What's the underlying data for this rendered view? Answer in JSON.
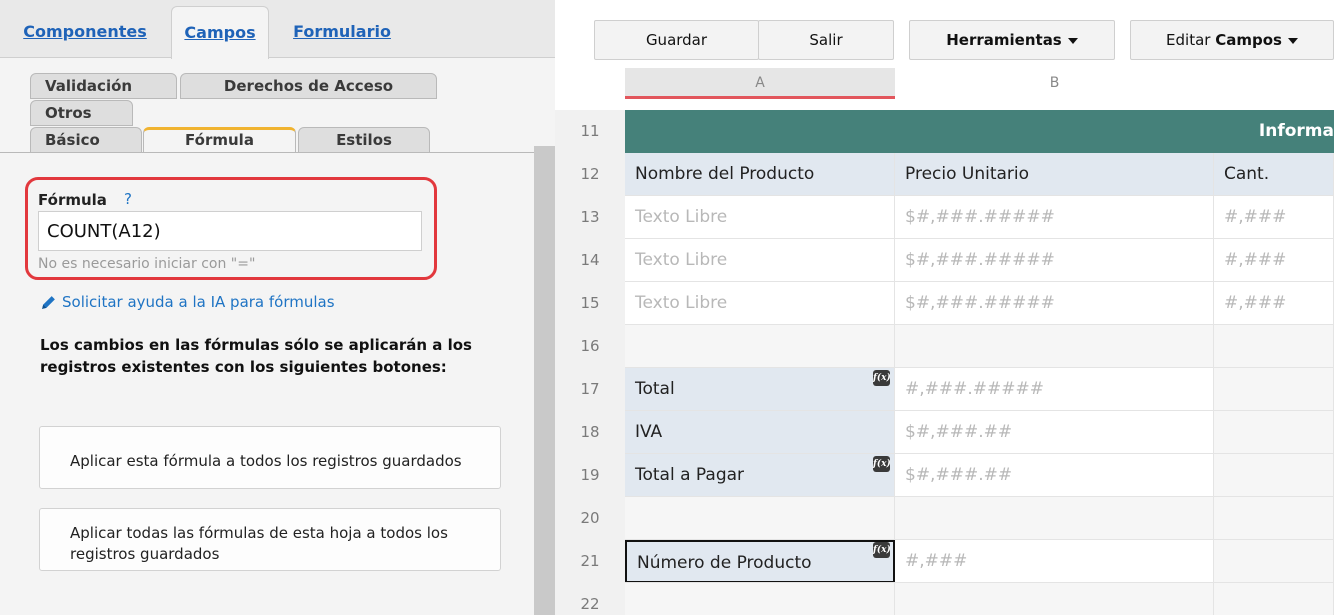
{
  "left_panel": {
    "top_tabs": [
      "Componentes",
      "Campos",
      "Formulario"
    ],
    "active_top_tab": "Campos",
    "sub_tabs_row1": [
      "Validación",
      "Derechos de Acceso"
    ],
    "sub_tabs_row2": [
      "Otros"
    ],
    "sub_tabs_row3": [
      "Básico",
      "Fórmula",
      "Estilos"
    ],
    "active_sub_tab": "Fórmula",
    "formula": {
      "label": "Fórmula",
      "help": "?",
      "value": "COUNT(A12)",
      "hint": "No es necesario iniciar con \"=\""
    },
    "ai_link": "Solicitar ayuda a la IA para fórmulas",
    "warning": "Los cambios en las fórmulas sólo se aplicarán a los registros existentes con los siguientes botones:",
    "apply_one": "Aplicar esta fórmula a todos los registros guardados",
    "apply_all": "Aplicar todas las fórmulas de esta hoja a todos los registros guardados"
  },
  "toolbar": {
    "save": "Guardar",
    "exit": "Salir",
    "tools": "Herramientas",
    "edit_prefix": "Editar",
    "edit_bold": "Campos"
  },
  "sheet": {
    "columns": [
      "A",
      "B"
    ],
    "rows": [
      {
        "num": "11",
        "a": "",
        "b": "",
        "c": "Informa",
        "header": true
      },
      {
        "num": "12",
        "a": "Nombre del Producto",
        "b": "Precio Unitario",
        "c": "Cant.",
        "label": true
      },
      {
        "num": "13",
        "a": "Texto Libre",
        "b": "$#,###.#####",
        "c": "#,###",
        "placeholder": true
      },
      {
        "num": "14",
        "a": "Texto Libre",
        "b": "$#,###.#####",
        "c": "#,###",
        "placeholder": true
      },
      {
        "num": "15",
        "a": "Texto Libre",
        "b": "$#,###.#####",
        "c": "#,###",
        "placeholder": true
      },
      {
        "num": "16",
        "a": "",
        "b": "",
        "c": ""
      },
      {
        "num": "17",
        "a": "Total",
        "b": "#,###.#####",
        "c": "",
        "fx": true
      },
      {
        "num": "18",
        "a": "IVA",
        "b": "$#,###.##",
        "c": ""
      },
      {
        "num": "19",
        "a": "Total a Pagar",
        "b": "$#,###.##",
        "c": "",
        "fx": true
      },
      {
        "num": "20",
        "a": "",
        "b": "",
        "c": ""
      },
      {
        "num": "21",
        "a": "Número de Producto",
        "b": "#,###",
        "c": "",
        "fx": true,
        "selected": true
      },
      {
        "num": "22",
        "a": "",
        "b": "",
        "c": ""
      }
    ]
  },
  "colors": {
    "accent_header": "#45817a",
    "label_cell": "#e1e8f0",
    "highlight": "#e2383d",
    "link": "#1f74c4"
  }
}
